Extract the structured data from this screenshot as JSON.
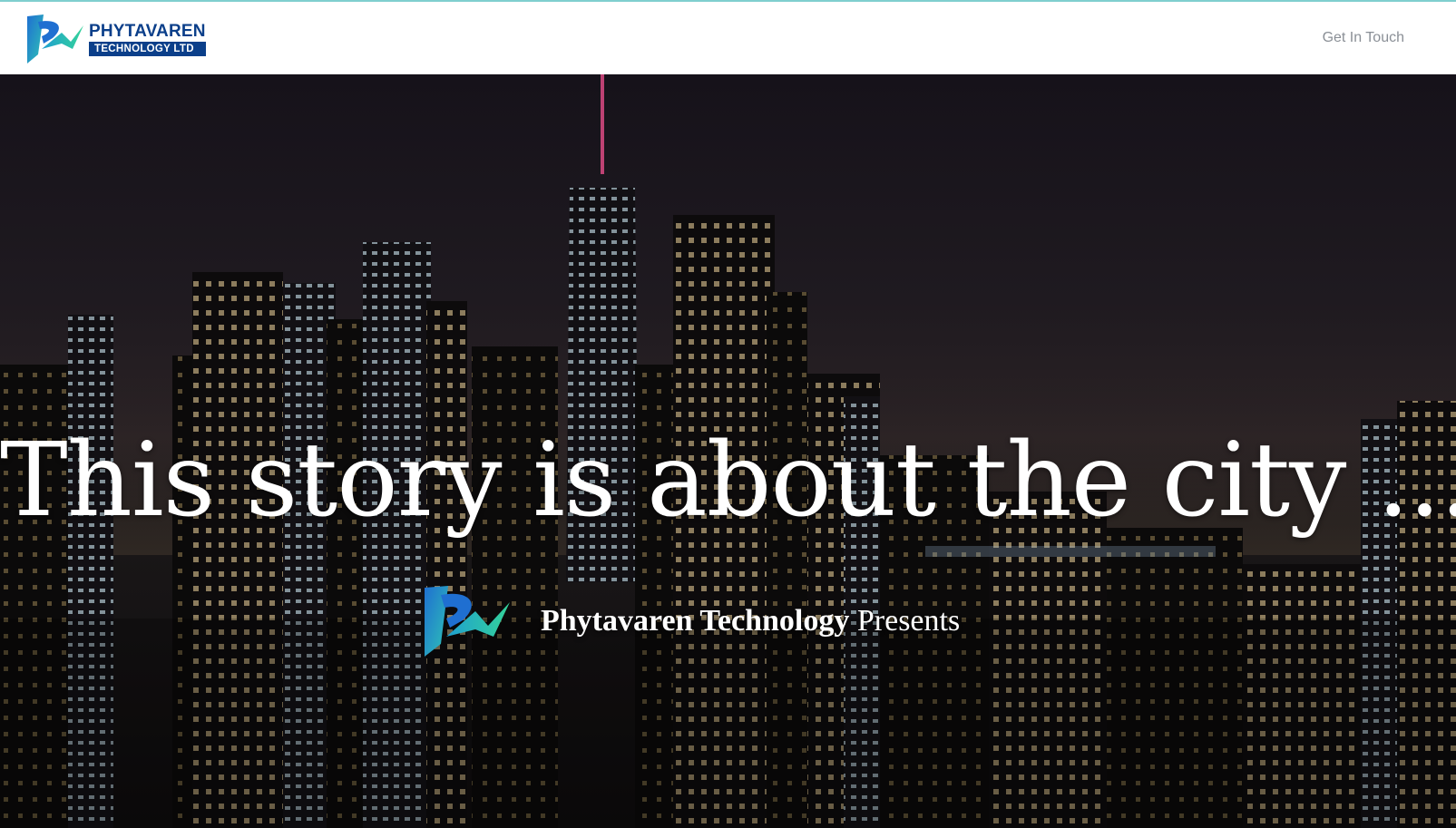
{
  "header": {
    "logo": {
      "name": "PHYTAVAREN",
      "subtitle": "TECHNOLOGY LTD",
      "icon": "phytavaren-logo-icon"
    },
    "nav": {
      "cta_label": "Get In Touch"
    }
  },
  "hero": {
    "headline": "This story is about the city ...",
    "presents": {
      "brand": "Phytavaren Technology",
      "suffix": "Presents",
      "icon": "phytavaren-logo-icon"
    },
    "background": "night-city-skyline-image"
  },
  "colors": {
    "brand_navy": "#0b3f8a",
    "brand_teal": "#2ec4b6",
    "brand_blue": "#1f6fd1",
    "nav_text": "#8a8f96",
    "top_accent": "#7fcfcf"
  }
}
